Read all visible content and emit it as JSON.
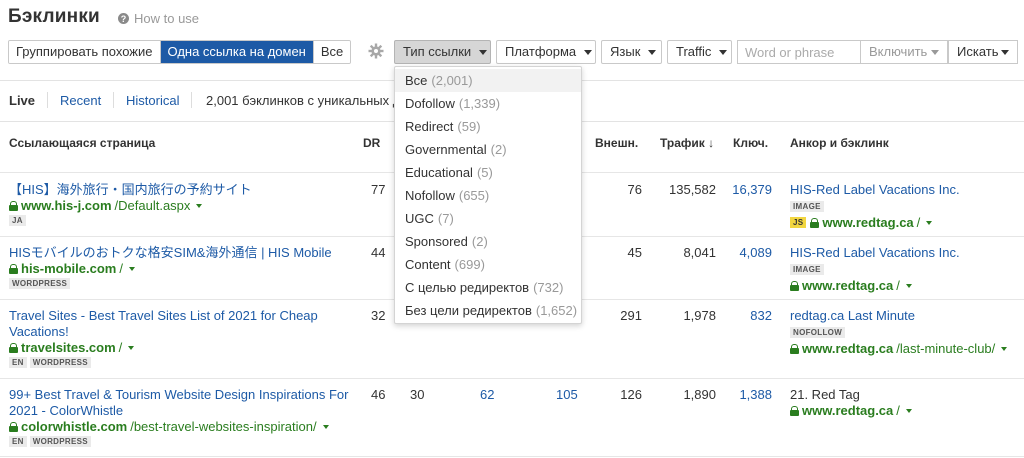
{
  "header": {
    "title": "Бэклинки",
    "how_to": "How to use"
  },
  "toolbar": {
    "segment": [
      "Группировать похожие",
      "Одна ссылка на домен",
      "Все"
    ],
    "link_type": "Тип ссылки",
    "platform": "Платформа",
    "language": "Язык",
    "traffic": "Traffic",
    "search_placeholder": "Word or phrase",
    "include": "Включить",
    "search": "Искать"
  },
  "tabs": {
    "live": "Live",
    "recent": "Recent",
    "historical": "Historical",
    "summary": "2,001 бэклинков с уникальных д"
  },
  "table": {
    "headers": {
      "ref_page": "Ссылающаяся страница",
      "dr": "DR",
      "ext": "Внешн.",
      "traffic": "Трафик",
      "kw": "Ключ.",
      "anchor": "Анкор и бэклинк"
    },
    "rows": [
      {
        "title": "【HIS】海外旅行・国内旅行の予約サイト",
        "domain": "www.his-j.com",
        "path": "/Default.aspx",
        "badges": [
          "JA"
        ],
        "dr": "77",
        "ext": "76",
        "traffic": "135,582",
        "kw": "16,379",
        "anchor": "HIS-Red Label Vacations Inc.",
        "anchor_badges": [
          "IMAGE"
        ],
        "target_badge": "JS",
        "target_domain": "www.redtag.ca",
        "target_path": "/"
      },
      {
        "title": "HISモバイルのおトクな格安SIM&海外通信 | HIS Mobile",
        "domain": "his-mobile.com",
        "path": "/",
        "badges": [
          "WORDPRESS"
        ],
        "dr": "44",
        "ext": "45",
        "traffic": "8,041",
        "kw": "4,089",
        "anchor": "HIS-Red Label Vacations Inc.",
        "anchor_badges": [
          "IMAGE"
        ],
        "target_domain": "www.redtag.ca",
        "target_path": "/"
      },
      {
        "title_l1": "Travel Sites - Best Travel Sites List of 2021 for Cheap",
        "title_l2": "Vacations!",
        "domain": "travelsites.com",
        "path": "/",
        "badges": [
          "EN",
          "WORDPRESS"
        ],
        "dr": "32",
        "ext": "291",
        "traffic": "1,978",
        "kw": "832",
        "anchor": "redtag.ca Last Minute",
        "anchor_badges": [
          "NOFOLLOW"
        ],
        "target_domain": "www.redtag.ca",
        "target_path": "/last-minute-club/"
      },
      {
        "title_l1": "99+ Best Travel & Tourism Website Design Inspirations For",
        "title_l2": "2021 - ColorWhistle",
        "domain": "colorwhistle.com",
        "path": "/best-travel-websites-inspiration/",
        "badges": [
          "EN",
          "WORDPRESS"
        ],
        "dr": "46",
        "c3": "30",
        "c4": "62",
        "c5": "105",
        "ext": "126",
        "traffic": "1,890",
        "kw": "1,388",
        "anchor": "21. Red Tag",
        "target_domain": "www.redtag.ca",
        "target_path": "/"
      }
    ]
  },
  "dropdown": {
    "items": [
      {
        "label": "Все",
        "count": "(2,001)"
      },
      {
        "label": "Dofollow",
        "count": "(1,339)"
      },
      {
        "label": "Redirect",
        "count": "(59)"
      },
      {
        "label": "Governmental",
        "count": "(2)"
      },
      {
        "label": "Educational",
        "count": "(5)"
      },
      {
        "label": "Nofollow",
        "count": "(655)"
      },
      {
        "label": "UGC",
        "count": "(7)"
      },
      {
        "label": "Sponsored",
        "count": "(2)"
      },
      {
        "label": "Content",
        "count": "(699)"
      },
      {
        "label": "С целью редиректов",
        "count": "(732)"
      },
      {
        "label": "Без цели редиректов",
        "count": "(1,652)"
      }
    ]
  },
  "colors": {
    "accent": "#1d5aa6",
    "url_green": "#2a7d1f",
    "js_badge": "#f2d640"
  }
}
